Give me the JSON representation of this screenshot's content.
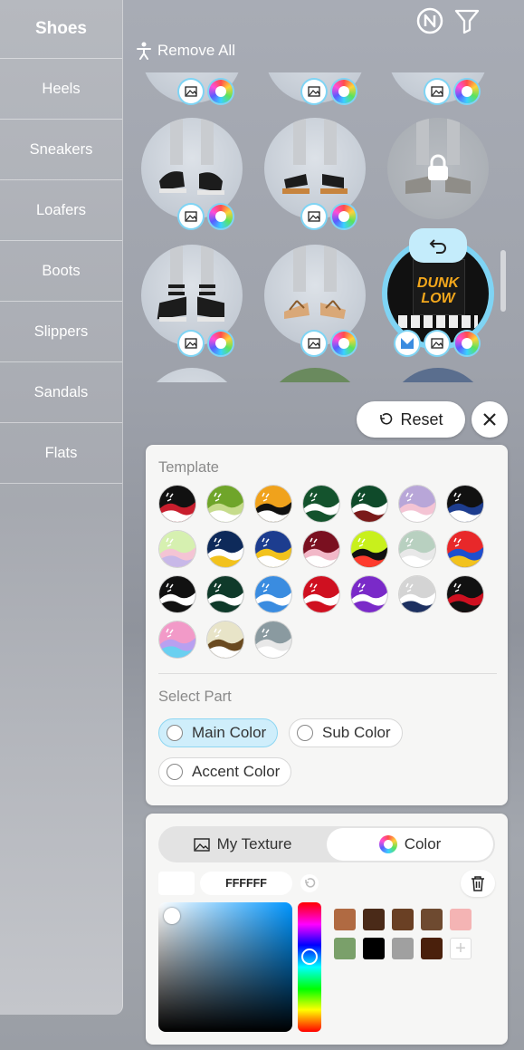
{
  "sidebar": {
    "title": "Shoes",
    "items": [
      {
        "label": "Heels"
      },
      {
        "label": "Sneakers"
      },
      {
        "label": "Loafers"
      },
      {
        "label": "Boots"
      },
      {
        "label": "Slippers"
      },
      {
        "label": "Sandals"
      },
      {
        "label": "Flats"
      }
    ]
  },
  "toolbar": {
    "remove_all": "Remove All",
    "n_icon": "n-circle-icon",
    "filter_icon": "filter-icon"
  },
  "grid": {
    "items": [
      {
        "name": "black-sandals",
        "locked": false
      },
      {
        "name": "brown-slides",
        "locked": false
      },
      {
        "name": "grey-slides",
        "locked": true
      },
      {
        "name": "black-gladiator",
        "locked": false
      },
      {
        "name": "tan-flip-flops",
        "locked": false
      },
      {
        "name": "dunk-low",
        "selected": true,
        "label_line1": "DUNK",
        "label_line2": "LOW"
      }
    ]
  },
  "actions": {
    "reset": "Reset"
  },
  "template": {
    "title": "Template",
    "swatches": [
      [
        "#111111",
        "#c81e2d",
        "#ffffff"
      ],
      [
        "#6fa52a",
        "#c6dc8c",
        "#ffffff"
      ],
      [
        "#f0a21c",
        "#111111",
        "#ffffff"
      ],
      [
        "#14532d",
        "#ffffff",
        "#14532d"
      ],
      [
        "#0f4a2a",
        "#ffffff",
        "#7a1a1a"
      ],
      [
        "#b8a6d8",
        "#f4c4d4",
        "#ffffff"
      ],
      [
        "#111111",
        "#1d3d8f",
        "#ffffff"
      ],
      [
        "#d6f0b0",
        "#f4c4d4",
        "#c8b8e8"
      ],
      [
        "#0e2a5a",
        "#ffffff",
        "#f2c21c"
      ],
      [
        "#1d3d8f",
        "#f2c21c",
        "#ffffff"
      ],
      [
        "#7a1020",
        "#f2b8c8",
        "#ffffff"
      ],
      [
        "#c8f01c",
        "#111111",
        "#ff3b2d"
      ],
      [
        "#b8d0c0",
        "#e8e8e8",
        "#ffffff"
      ],
      [
        "#e8282a",
        "#1d4fcf",
        "#f2c21c"
      ],
      [
        "#111111",
        "#ffffff",
        "#111111"
      ],
      [
        "#0f3a2a",
        "#ffffff",
        "#0f3a2a"
      ],
      [
        "#3a8ce0",
        "#ffffff",
        "#3a8ce0"
      ],
      [
        "#cf1020",
        "#ffffff",
        "#cf1020"
      ],
      [
        "#7a2ac8",
        "#ffffff",
        "#7a2ac8"
      ],
      [
        "#d4d4d4",
        "#ffffff",
        "#1d3060"
      ],
      [
        "#111111",
        "#cf1020",
        "#111111"
      ],
      [
        "#f29ac8",
        "#b8a0f0",
        "#6ad0f0"
      ],
      [
        "#e8e4c8",
        "#6a4a20",
        "#ffffff"
      ],
      [
        "#8a9aa0",
        "#e8e8e8",
        "#ffffff"
      ]
    ]
  },
  "select_part": {
    "title": "Select Part",
    "parts": [
      {
        "label": "Main Color"
      },
      {
        "label": "Sub Color"
      },
      {
        "label": "Accent Color"
      }
    ]
  },
  "color_panel": {
    "tab_texture": "My Texture",
    "tab_color": "Color",
    "hex_value": "FFFFFF",
    "palette": [
      "#b06a42",
      "#4a2a18",
      "#6a4024",
      "#6e4a30",
      "#f4b4b4",
      "#7aa06a",
      "#000000",
      "#a0a0a0",
      "#4a200c"
    ]
  }
}
